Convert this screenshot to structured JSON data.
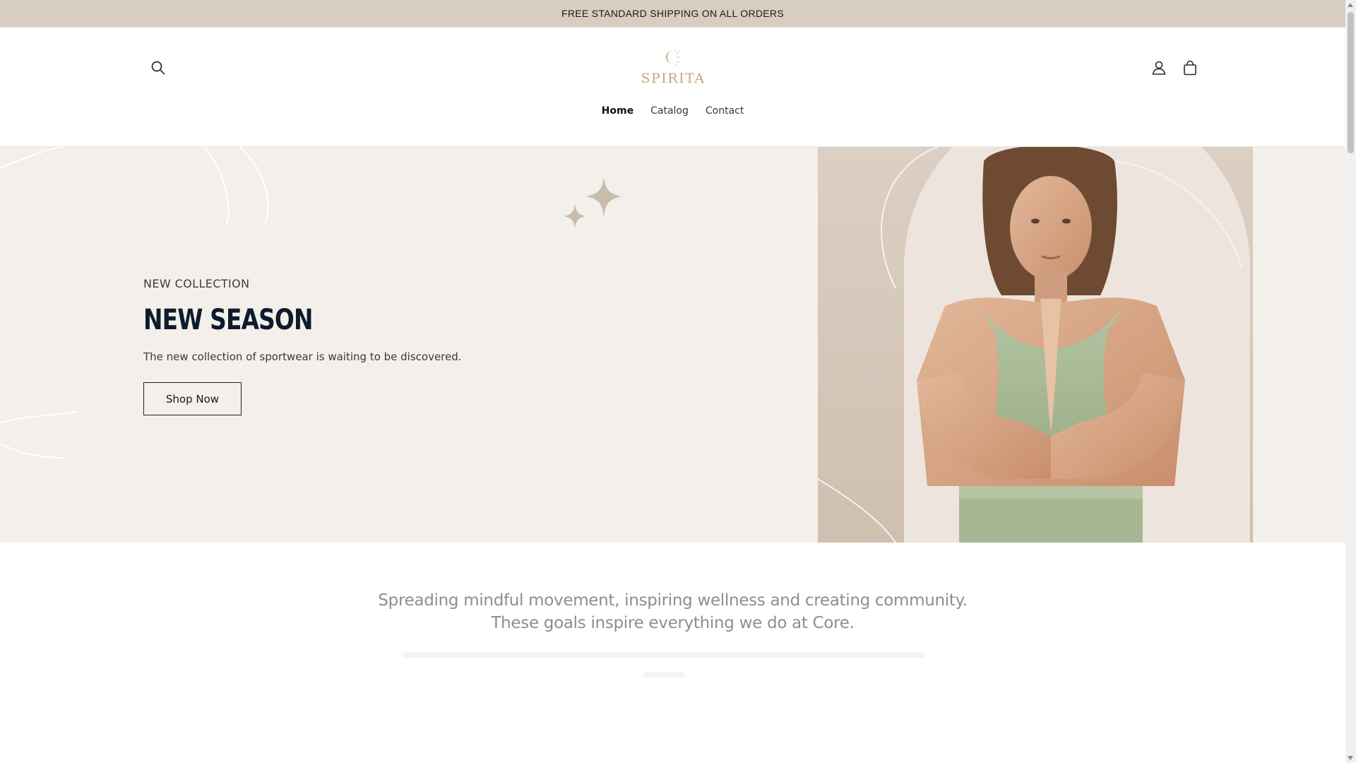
{
  "announcement": {
    "text": "FREE STANDARD SHIPPING ON ALL ORDERS"
  },
  "header": {
    "logo_text": "SPIRITA",
    "icons": {
      "search": "search-icon",
      "account": "user-icon",
      "cart": "cart-icon"
    }
  },
  "nav": {
    "items": [
      {
        "label": "Home",
        "active": true
      },
      {
        "label": "Catalog",
        "active": false
      },
      {
        "label": "Contact",
        "active": false
      }
    ]
  },
  "hero": {
    "eyebrow": "NEW COLLECTION",
    "title": "NEW SEASON",
    "description": "The new collection of sportwear is waiting to be discovered.",
    "cta_label": "Shop Now"
  },
  "mission": {
    "line1": "Spreading mindful movement, inspiring wellness and creating community.",
    "line2": "These goals inspire everything we do at Core."
  },
  "colors": {
    "announcement_bg": "#d8cdc1",
    "hero_bg": "#f3efeb",
    "logo_gold": "#c6a67a",
    "title_navy": "#0e1b2c"
  }
}
